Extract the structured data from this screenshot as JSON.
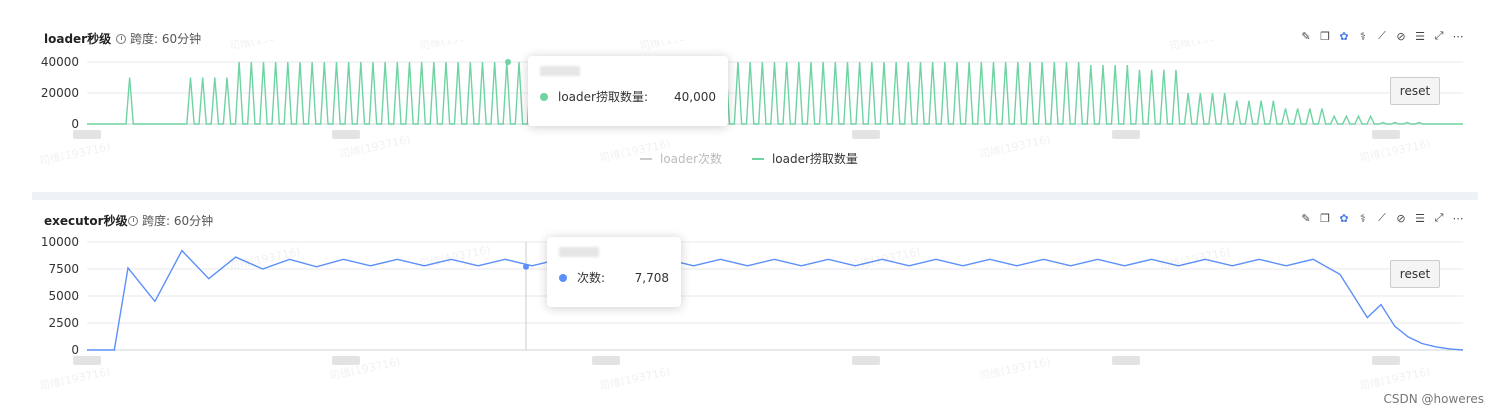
{
  "charts": [
    {
      "title": "loader秒级",
      "span_label": "跨度: 60分钟",
      "reset_label": "reset",
      "legend": [
        {
          "name": "loader次数",
          "color": "#bbbbbb",
          "visible": false
        },
        {
          "name": "loader捞取数量",
          "color": "#6fd3a2",
          "visible": true
        }
      ],
      "tooltip": {
        "label": "loader捞取数量:",
        "value": "40,000",
        "color": "#6fd3a2"
      }
    },
    {
      "title": "executor秒级",
      "span_label": "跨度: 60分钟",
      "reset_label": "reset",
      "tooltip": {
        "label": "次数:",
        "value": "7,708",
        "color": "#5b8ff9"
      }
    }
  ],
  "toolbar_icons": [
    "edit-icon",
    "copy-icon",
    "settings-flower-icon",
    "stethoscope-icon",
    "line-chart-icon",
    "compass-icon",
    "list-icon",
    "fullscreen-icon",
    "more-icon"
  ],
  "chart_data": [
    {
      "type": "line",
      "title": "loader秒级",
      "series": [
        {
          "name": "loader次数",
          "color": "#bbbbbb",
          "visible": false,
          "values": []
        },
        {
          "name": "loader捞取数量",
          "color": "#6fd3a2",
          "pattern": "periodic pulses: ~40000 peaks with returns to 0, starting with a 30000 spike, tapering to 20000/15000/10000/5000 at the end",
          "peak_value": 40000,
          "values": [
            0,
            30000,
            40000,
            40000,
            40000,
            40000,
            40000,
            40000,
            40000,
            40000,
            40000,
            40000,
            40000,
            40000,
            40000,
            40000,
            40000,
            40000,
            40000,
            38000,
            35000,
            20000,
            15000,
            10000,
            5000,
            1000,
            0
          ]
        }
      ],
      "yticks": [
        0,
        20000,
        40000
      ],
      "ylim": [
        0,
        40000
      ],
      "grid": true
    },
    {
      "type": "line",
      "title": "executor秒级",
      "series": [
        {
          "name": "次数",
          "color": "#5b8ff9",
          "values": [
            0,
            0,
            0,
            7600,
            4500,
            9200,
            6600,
            8600,
            7500,
            8400,
            7700,
            8400,
            7800,
            8400,
            7800,
            8400,
            7800,
            8400,
            7800,
            8400,
            7708,
            8400,
            7800,
            8400,
            7800,
            8400,
            7800,
            8400,
            7800,
            8400,
            7800,
            8400,
            7800,
            8400,
            7800,
            8400,
            7800,
            8400,
            7800,
            8400,
            7800,
            8400,
            7800,
            8400,
            7800,
            8400,
            7800,
            8400,
            7000,
            5000,
            3000,
            4200,
            2200,
            1200,
            600,
            300,
            100,
            0
          ]
        }
      ],
      "yticks": [
        0,
        2500,
        5000,
        7500,
        10000
      ],
      "ylim": [
        0,
        10000
      ],
      "grid": true
    }
  ],
  "watermark": {
    "text": "司维(193716)"
  },
  "footer": "CSDN @howeres"
}
